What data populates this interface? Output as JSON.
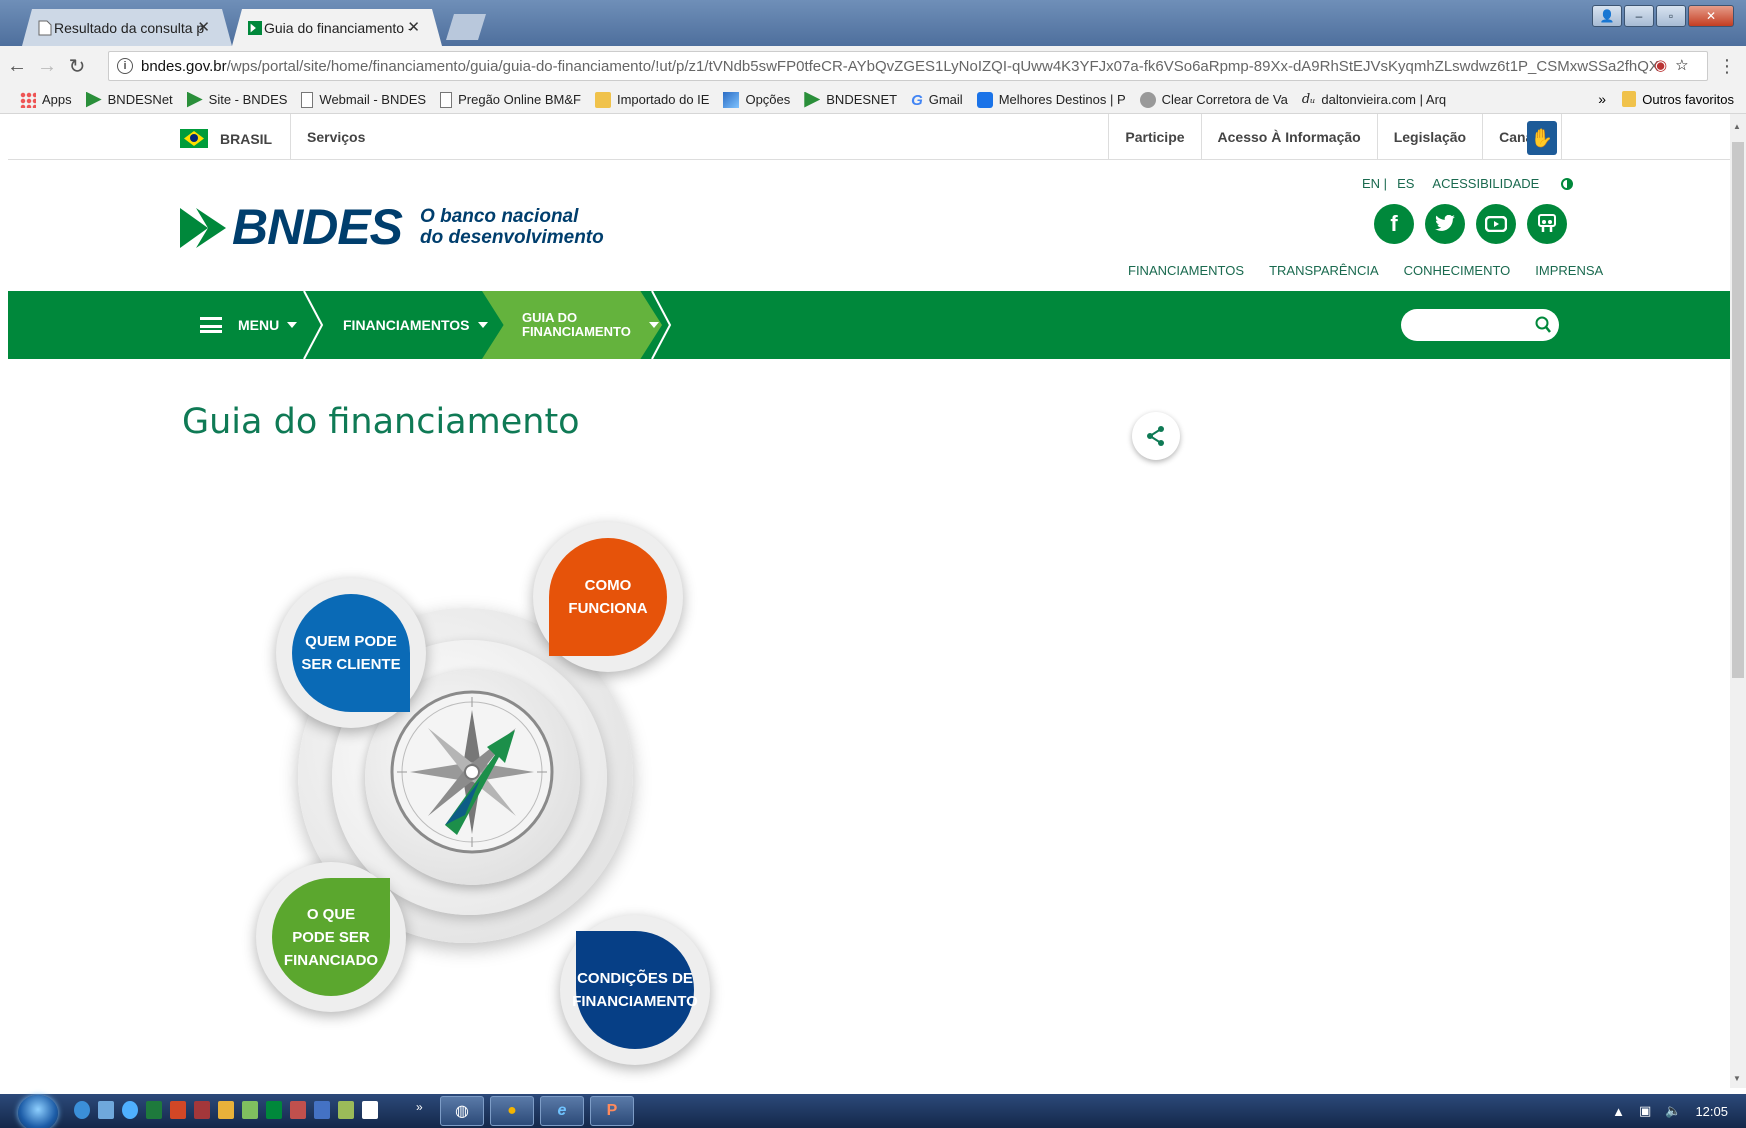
{
  "browser": {
    "tabs": [
      {
        "title": "Resultado da consulta pr"
      },
      {
        "title": "Guia do financiamento -"
      }
    ],
    "url_host": "bndes.gov.br",
    "url_path": "/wps/portal/site/home/financiamento/guia/guia-do-financiamento/!ut/p/z1/tVNdb5swFP0tfeCR-AYbQvZGES1LyNoIZQI-qUww4K3YFJx07a-fk6VSo6aRpmp-89Xx-dA9RhStEJVsKyqmhZLswdwz6t1P_CSMxwSSa2fhQX",
    "bookmarks": [
      {
        "label": "Apps",
        "icon": "apps-icon"
      },
      {
        "label": "BNDESNet",
        "icon": "bndes-icon"
      },
      {
        "label": "Site - BNDES",
        "icon": "bndes-icon"
      },
      {
        "label": "Webmail - BNDES",
        "icon": "page-icon"
      },
      {
        "label": "Pregão Online  BM&F",
        "icon": "page-icon"
      },
      {
        "label": "Importado do IE",
        "icon": "folder-icon"
      },
      {
        "label": "Opções",
        "icon": "chart-icon"
      },
      {
        "label": "BNDESNET",
        "icon": "bndes-icon"
      },
      {
        "label": "Gmail",
        "icon": "google-icon"
      },
      {
        "label": "Melhores Destinos | P",
        "icon": "map-icon"
      },
      {
        "label": "Clear Corretora de Va",
        "icon": "gear-icon"
      },
      {
        "label": "daltonvieira.com | Arq",
        "icon": "du-icon"
      }
    ],
    "more": "»",
    "other_bookmarks": "Outros favoritos"
  },
  "gov": {
    "brasil": "BRASIL",
    "servicos": "Serviços",
    "links": [
      "Participe",
      "Acesso À Informação",
      "Legislação",
      "Canais"
    ]
  },
  "header": {
    "logo": "BNDES",
    "tagline_1": "O banco nacional",
    "tagline_2": "do desenvolvimento",
    "lang_en": "EN |",
    "lang_es": "ES",
    "accessibility": "ACESSIBILIDADE",
    "top_links": [
      "FINANCIAMENTOS",
      "TRANSPARÊNCIA",
      "CONHECIMENTO",
      "IMPRENSA"
    ]
  },
  "nav": {
    "menu": "MENU",
    "financiamentos": "FINANCIAMENTOS",
    "guia_1": "GUIA DO",
    "guia_2": "FINANCIAMENTO",
    "search_placeholder": ""
  },
  "main": {
    "title": "Guia do financiamento",
    "bubbles": {
      "quem": [
        "QUEM PODE",
        "SER CLIENTE"
      ],
      "como": [
        "COMO",
        "FUNCIONA"
      ],
      "oque": [
        "O QUE",
        "PODE SER",
        "FINANCIADO"
      ],
      "cond": [
        "CONDIÇÕES DE",
        "FINANCIAMENTO"
      ]
    }
  },
  "taskbar": {
    "clock": "12:05"
  },
  "colors": {
    "bndes_green": "#00883b",
    "light_green": "#64b33d",
    "bndes_blue": "#003e6d",
    "bubble_blue": "#0a6ab6",
    "bubble_orange": "#e6530a",
    "bubble_green": "#5ba72e",
    "bubble_navy": "#063f86"
  }
}
